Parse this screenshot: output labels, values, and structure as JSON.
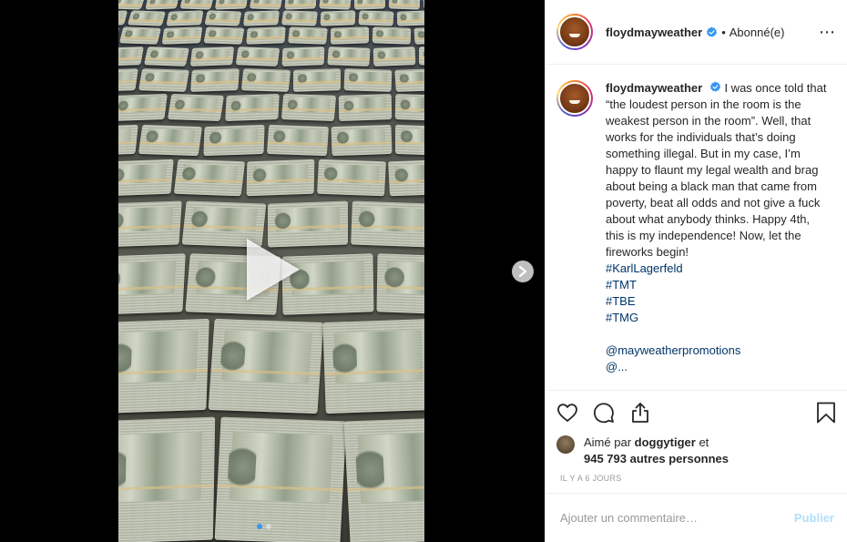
{
  "post": {
    "username": "floydmayweather",
    "separator": "•",
    "follow_status": "Abonné(e)",
    "more_icon": "⋯",
    "caption": {
      "username": "floydmayweather",
      "text": "I was once told that “the loudest person in the room is the weakest person in the room”. Well, that works for the individuals that’s doing something illegal. But in my case, I’m happy to flaunt my legal wealth and brag about being a black man that came from poverty, beat all odds and not give a fuck about what anybody thinks. Happy 4th, this is my independence! Now, let the fireworks begin!",
      "hashtags": [
        "#KarlLagerfeld",
        "#TMT",
        "#TBE",
        "#TMG"
      ],
      "mention": "@mayweatherpromotions",
      "partial_mention": "@..."
    },
    "likes": {
      "prefix": "Aimé par",
      "user": "doggytiger",
      "conjunction": "et",
      "others": "945 793 autres personnes"
    },
    "timestamp": "IL Y A 6 JOURS",
    "comment_placeholder": "Ajouter un commentaire…",
    "post_button": "Publier"
  },
  "colors": {
    "verified": "#3897f0",
    "link": "#003569",
    "publish_disabled": "#b2dffc",
    "carousel_active_dot": "#3897f0"
  },
  "carousel": {
    "current": 1,
    "total": 2
  },
  "icons": [
    "play-icon",
    "chevron-right-icon",
    "heart-icon",
    "comment-icon",
    "share-icon",
    "bookmark-icon",
    "verified-badge-icon"
  ]
}
